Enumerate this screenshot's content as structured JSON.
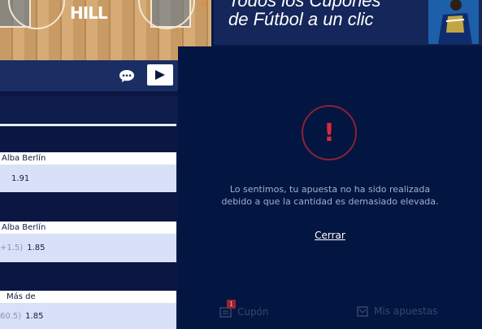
{
  "stream": {
    "court_logo_text": "HILL"
  },
  "banner": {
    "line1": "Todos los Cupones",
    "line2": "de Fútbol a un clic"
  },
  "markets": [
    {
      "header": "Alba Berlín",
      "handicap": "",
      "odds": "1.91"
    },
    {
      "header": "Alba Berlín",
      "handicap": "+1.5)",
      "odds": "1.85"
    },
    {
      "header": "Más de",
      "handicap": "60.5)",
      "odds": "1.85"
    }
  ],
  "modal": {
    "alert_symbol": "!",
    "message_line1": "Lo sentimos, tu apuesta no ha sido realizada",
    "message_line2": "debido a que la cantidad es demasiado elevada.",
    "close_label": "Cerrar"
  },
  "bottom_nav": {
    "cupon_label": "Cupón",
    "cupon_count": "1",
    "my_bets_label": "Mis apuestas"
  },
  "colors": {
    "panel_bg": "#031641",
    "alert_red": "#d62b3c",
    "page_bg": "#0a1a45"
  }
}
